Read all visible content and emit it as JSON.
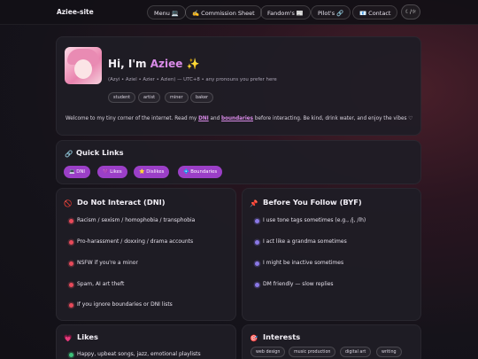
{
  "nav": {
    "brand": "Aziee-site",
    "links": [
      "Menu 💻",
      "✍️ Commission Sheet",
      "Fandom's 📰",
      "Pilot's 🔗",
      "📧 Contact"
    ],
    "theme_toggle": "☾/☼"
  },
  "profile": {
    "greeting": "Hi, I'm",
    "name": "Aziee",
    "sparkle": "✨",
    "subtitle": "(Azyi • Aziel • Azier • Azien) — UTC+8 • any pronouns you prefer here",
    "tags": [
      "student",
      "artist",
      "miner",
      "baker"
    ],
    "welcome_pre": "Welcome to my tiny corner of the internet. Read my",
    "welcome_link1": "DNI",
    "welcome_and": "and",
    "welcome_link2": "boundaries",
    "welcome_post": "before interacting. Be kind, drink water, and enjoy the vibes ♡"
  },
  "quick_links": {
    "icon": "🔗",
    "title": "Quick Links",
    "items": [
      "💻 DNI",
      "💜 Likes",
      "⭐ Dislikes",
      "💠 Boundaries"
    ]
  },
  "dni": {
    "icon": "🚫",
    "title": "Do Not Interact (DNI)",
    "items": [
      "Racism / sexism / homophobia / transphobia",
      "Pro-harassment / doxxing / drama accounts",
      "NSFW if you're a minor",
      "Spam, AI art theft",
      "If you ignore boundaries or DNI lists"
    ]
  },
  "byf": {
    "icon": "📌",
    "title": "Before You Follow (BYF)",
    "items": [
      "I use tone tags sometimes (e.g., /j, /lh)",
      "I act like a grandma sometimes",
      "I might be inactive sometimes",
      "DM friendly — slow replies"
    ]
  },
  "likes": {
    "icon": "💗",
    "title": "Likes",
    "items": [
      "Happy, upbeat songs, jazz, emotional playlists"
    ]
  },
  "interests": {
    "icon": "🎯",
    "title": "Interests",
    "chips": [
      "web design",
      "music production",
      "digital art",
      "writing"
    ]
  },
  "colors": {
    "accent": "#d98be8",
    "pill": "#9b3fc7",
    "dni_dot": "#e84a5a",
    "byf_dot": "#8a78e6",
    "likes_dot": "#3ec27a"
  }
}
